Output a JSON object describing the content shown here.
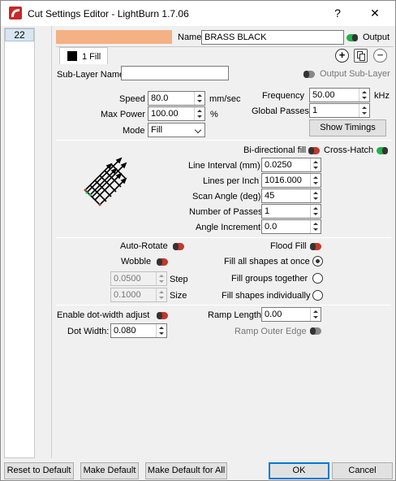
{
  "window": {
    "title": "Cut Settings Editor - LightBurn 1.7.06",
    "help_glyph": "?",
    "close_glyph": "✕"
  },
  "layer_list": {
    "items": [
      "22"
    ]
  },
  "colors": {
    "layer_swatch": "#f4b183",
    "toggle_on": "#22b14c",
    "toggle_off": "#c0392b",
    "accent": "#0078d7"
  },
  "name": {
    "label": "Name",
    "value": "BRASS BLACK",
    "output_label": "Output"
  },
  "tab": {
    "label": "1 Fill"
  },
  "icons": {
    "add": "plus-circle-icon",
    "copy": "copy-icon",
    "remove": "minus-circle-icon"
  },
  "sublayer": {
    "label": "Sub-Layer Name",
    "value": "",
    "output_label": "Output Sub-Layer"
  },
  "speed": {
    "label": "Speed",
    "value": "80.0",
    "unit": "mm/sec"
  },
  "max_power": {
    "label": "Max Power",
    "value": "100.00",
    "unit": "%"
  },
  "mode": {
    "label": "Mode",
    "value": "Fill"
  },
  "frequency": {
    "label": "Frequency",
    "value": "50.00",
    "unit": "kHz"
  },
  "global_passes": {
    "label": "Global Passes",
    "value": "1"
  },
  "show_timings": "Show Timings",
  "fill": {
    "bidirectional_label": "Bi-directional fill",
    "crosshatch_label": "Cross-Hatch",
    "line_interval": {
      "label": "Line Interval (mm)",
      "value": "0.0250"
    },
    "lines_per_inch": {
      "label": "Lines per Inch",
      "value": "1016.000"
    },
    "scan_angle": {
      "label": "Scan Angle (deg)",
      "value": "45"
    },
    "num_passes": {
      "label": "Number of Passes",
      "value": "1"
    },
    "angle_increment": {
      "label": "Angle Increment",
      "value": "0.0"
    }
  },
  "options": {
    "auto_rotate": "Auto-Rotate",
    "wobble": "Wobble",
    "step": {
      "label": "Step",
      "value": "0.0500"
    },
    "size": {
      "label": "Size",
      "value": "0.1000"
    },
    "flood_fill": "Flood Fill",
    "fill_all": "Fill all shapes at once",
    "fill_groups": "Fill groups together",
    "fill_individual": "Fill shapes individually"
  },
  "dot": {
    "enable_label": "Enable dot-width adjust",
    "dot_width": {
      "label": "Dot Width:",
      "value": "0.080"
    },
    "ramp_length": {
      "label": "Ramp Length",
      "value": "0.00"
    },
    "ramp_outer": "Ramp Outer Edge"
  },
  "footer": {
    "reset": "Reset to Default",
    "make_default": "Make Default",
    "make_default_all": "Make Default for All",
    "ok": "OK",
    "cancel": "Cancel"
  }
}
